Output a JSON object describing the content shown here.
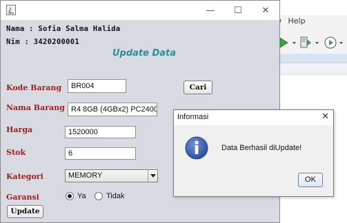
{
  "ide": {
    "menu_items": [
      "w",
      "Help"
    ]
  },
  "window": {
    "controls": {
      "minimize": "—",
      "maximize": "☐",
      "close": "✕"
    },
    "nama_line": "Nama : Sofia Salma Halida",
    "nim_line": "Nim : 3420200001",
    "heading": "Update Data"
  },
  "form": {
    "kode_barang": {
      "label": "Kode Barang",
      "value": "BR004"
    },
    "cari_button": "Cari",
    "nama_barang": {
      "label": "Nama Barang",
      "value": "R4 8GB (4GBx2) PC2400"
    },
    "harga": {
      "label": "Harga",
      "value": "1520000"
    },
    "stok": {
      "label": "Stok",
      "value": "6"
    },
    "kategori": {
      "label": "Kategori",
      "value": "MEMORY"
    },
    "garansi": {
      "label": "Garansi",
      "options": [
        "Ya",
        "Tidak"
      ],
      "selected": "Ya"
    },
    "update_button": "Update"
  },
  "dialog": {
    "title": "Informasi",
    "close": "✕",
    "message": "Data Berhasil diUpdate!",
    "ok_button": "OK",
    "icon": "information-icon"
  },
  "colors": {
    "label": "#9a1f1f",
    "heading": "#2a8f98",
    "window_bg": "#d9dbe3"
  }
}
